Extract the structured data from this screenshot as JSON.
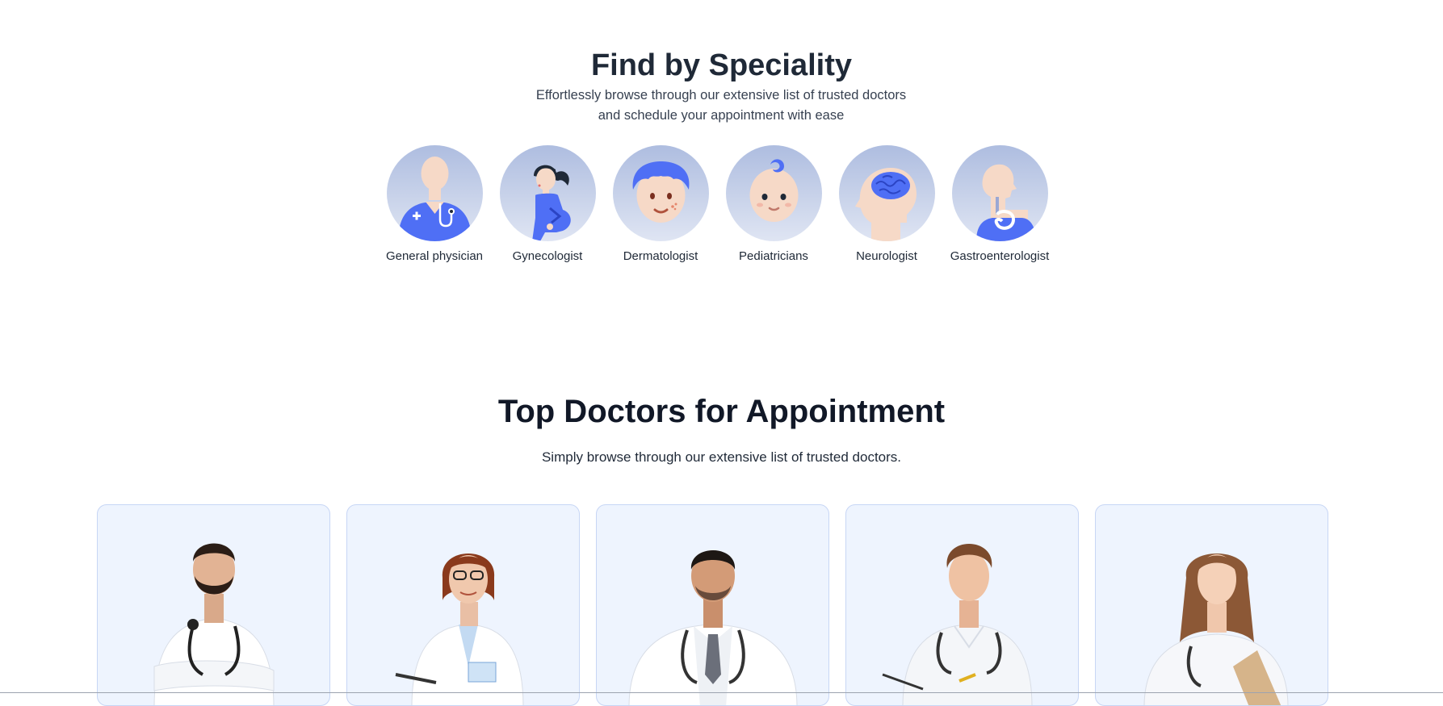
{
  "speciality": {
    "title": "Find by Speciality",
    "subtitle_line1": "Effortlessly browse through our extensive list of trusted doctors",
    "subtitle_line2": "and schedule your appointment with ease",
    "items": [
      {
        "label": "General physician",
        "icon": "general-physician-icon"
      },
      {
        "label": "Gynecologist",
        "icon": "gynecologist-icon"
      },
      {
        "label": "Dermatologist",
        "icon": "dermatologist-icon"
      },
      {
        "label": "Pediatricians",
        "icon": "pediatrician-icon"
      },
      {
        "label": "Neurologist",
        "icon": "neurologist-icon"
      },
      {
        "label": "Gastroenterologist",
        "icon": "gastroenterologist-icon"
      }
    ]
  },
  "top_doctors": {
    "title": "Top Doctors for Appointment",
    "subtitle": "Simply browse through our extensive list of trusted doctors.",
    "cards": [
      {
        "image": "doctor-photo"
      },
      {
        "image": "doctor-photo"
      },
      {
        "image": "doctor-photo"
      },
      {
        "image": "doctor-photo"
      },
      {
        "image": "doctor-photo"
      }
    ]
  },
  "colors": {
    "accent": "#5f6fff",
    "icon_blue": "#4f6ff5",
    "card_bg": "#eef4fe",
    "card_border": "#c7d6f5",
    "circle_bg": "#c9d3ea"
  }
}
